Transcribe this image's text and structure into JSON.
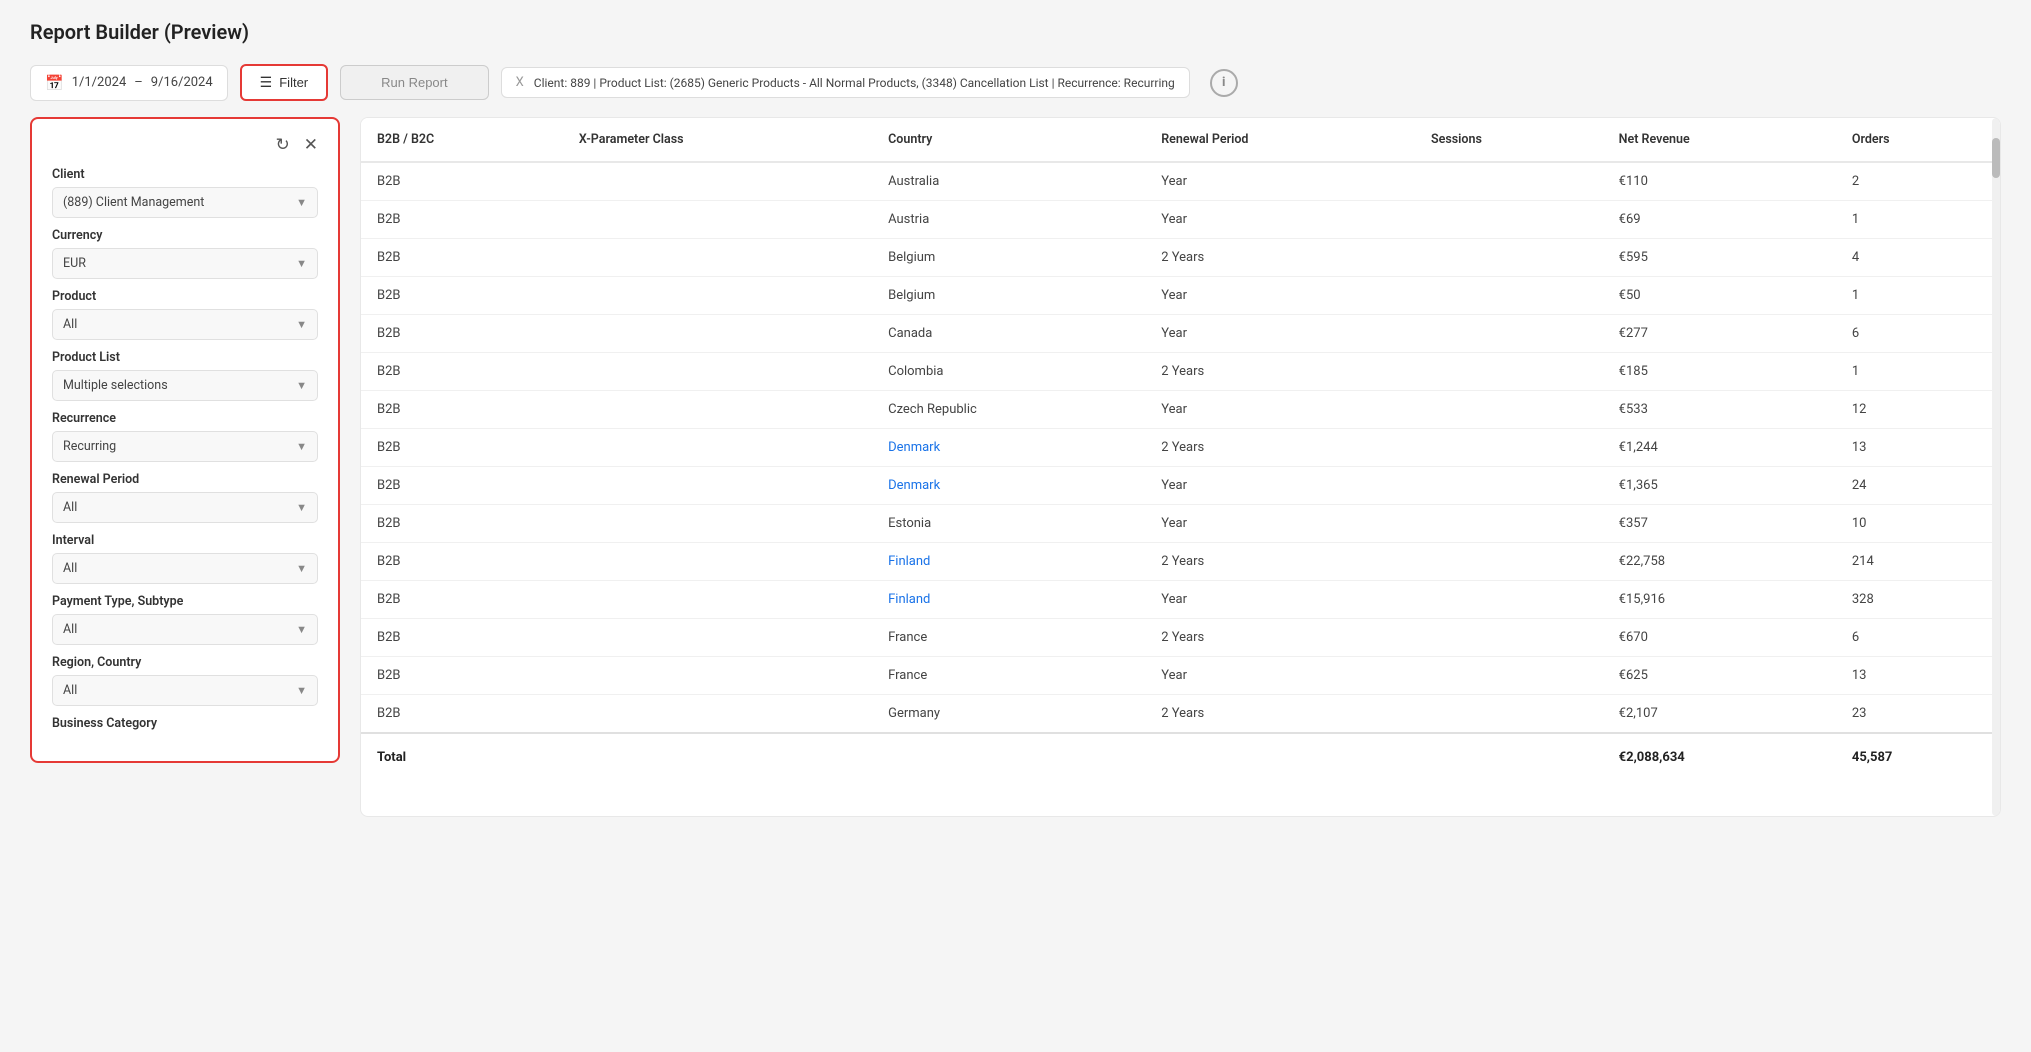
{
  "page": {
    "title": "Report Builder (Preview)"
  },
  "toolbar": {
    "date_start": "1/1/2024",
    "date_end": "9/16/2024",
    "filter_label": "Filter",
    "run_report_label": "Run Report",
    "active_filter": {
      "close": "X",
      "text": "Client: 889 | Product List: (2685) Generic Products - All Normal Products, (3348) Cancellation List | Recurrence: Recurring"
    },
    "info_label": "i"
  },
  "filter_panel": {
    "sections": [
      {
        "label": "Client",
        "value": "(889) Client Management"
      },
      {
        "label": "Currency",
        "value": "EUR"
      },
      {
        "label": "Product",
        "value": "All"
      },
      {
        "label": "Product List",
        "value": "Multiple selections"
      },
      {
        "label": "Recurrence",
        "value": "Recurring"
      },
      {
        "label": "Renewal Period",
        "value": "All"
      },
      {
        "label": "Interval",
        "value": "All"
      },
      {
        "label": "Payment Type, Subtype",
        "value": "All"
      },
      {
        "label": "Region, Country",
        "value": "All"
      },
      {
        "label": "Business Category",
        "value": ""
      }
    ]
  },
  "table": {
    "columns": [
      "B2B / B2C",
      "X-Parameter Class",
      "Country",
      "Renewal Period",
      "Sessions",
      "Net Revenue",
      "Orders"
    ],
    "rows": [
      {
        "b2b_b2c": "B2B",
        "x_param": "",
        "country": "Australia",
        "renewal_period": "Year",
        "sessions": "",
        "net_revenue": "€110",
        "orders": "2",
        "country_link": false
      },
      {
        "b2b_b2c": "B2B",
        "x_param": "",
        "country": "Austria",
        "renewal_period": "Year",
        "sessions": "",
        "net_revenue": "€69",
        "orders": "1",
        "country_link": false
      },
      {
        "b2b_b2c": "B2B",
        "x_param": "",
        "country": "Belgium",
        "renewal_period": "2 Years",
        "sessions": "",
        "net_revenue": "€595",
        "orders": "4",
        "country_link": false
      },
      {
        "b2b_b2c": "B2B",
        "x_param": "",
        "country": "Belgium",
        "renewal_period": "Year",
        "sessions": "",
        "net_revenue": "€50",
        "orders": "1",
        "country_link": false
      },
      {
        "b2b_b2c": "B2B",
        "x_param": "",
        "country": "Canada",
        "renewal_period": "Year",
        "sessions": "",
        "net_revenue": "€277",
        "orders": "6",
        "country_link": false
      },
      {
        "b2b_b2c": "B2B",
        "x_param": "",
        "country": "Colombia",
        "renewal_period": "2 Years",
        "sessions": "",
        "net_revenue": "€185",
        "orders": "1",
        "country_link": false
      },
      {
        "b2b_b2c": "B2B",
        "x_param": "",
        "country": "Czech Republic",
        "renewal_period": "Year",
        "sessions": "",
        "net_revenue": "€533",
        "orders": "12",
        "country_link": false
      },
      {
        "b2b_b2c": "B2B",
        "x_param": "",
        "country": "Denmark",
        "renewal_period": "2 Years",
        "sessions": "",
        "net_revenue": "€1,244",
        "orders": "13",
        "country_link": true
      },
      {
        "b2b_b2c": "B2B",
        "x_param": "",
        "country": "Denmark",
        "renewal_period": "Year",
        "sessions": "",
        "net_revenue": "€1,365",
        "orders": "24",
        "country_link": true
      },
      {
        "b2b_b2c": "B2B",
        "x_param": "",
        "country": "Estonia",
        "renewal_period": "Year",
        "sessions": "",
        "net_revenue": "€357",
        "orders": "10",
        "country_link": false
      },
      {
        "b2b_b2c": "B2B",
        "x_param": "",
        "country": "Finland",
        "renewal_period": "2 Years",
        "sessions": "",
        "net_revenue": "€22,758",
        "orders": "214",
        "country_link": true
      },
      {
        "b2b_b2c": "B2B",
        "x_param": "",
        "country": "Finland",
        "renewal_period": "Year",
        "sessions": "",
        "net_revenue": "€15,916",
        "orders": "328",
        "country_link": true
      },
      {
        "b2b_b2c": "B2B",
        "x_param": "",
        "country": "France",
        "renewal_period": "2 Years",
        "sessions": "",
        "net_revenue": "€670",
        "orders": "6",
        "country_link": false
      },
      {
        "b2b_b2c": "B2B",
        "x_param": "",
        "country": "France",
        "renewal_period": "Year",
        "sessions": "",
        "net_revenue": "€625",
        "orders": "13",
        "country_link": false
      },
      {
        "b2b_b2c": "B2B",
        "x_param": "",
        "country": "Germany",
        "renewal_period": "2 Years",
        "sessions": "",
        "net_revenue": "€2,107",
        "orders": "23",
        "country_link": false
      }
    ],
    "total": {
      "label": "Total",
      "net_revenue": "€2,088,634",
      "orders": "45,587"
    }
  }
}
